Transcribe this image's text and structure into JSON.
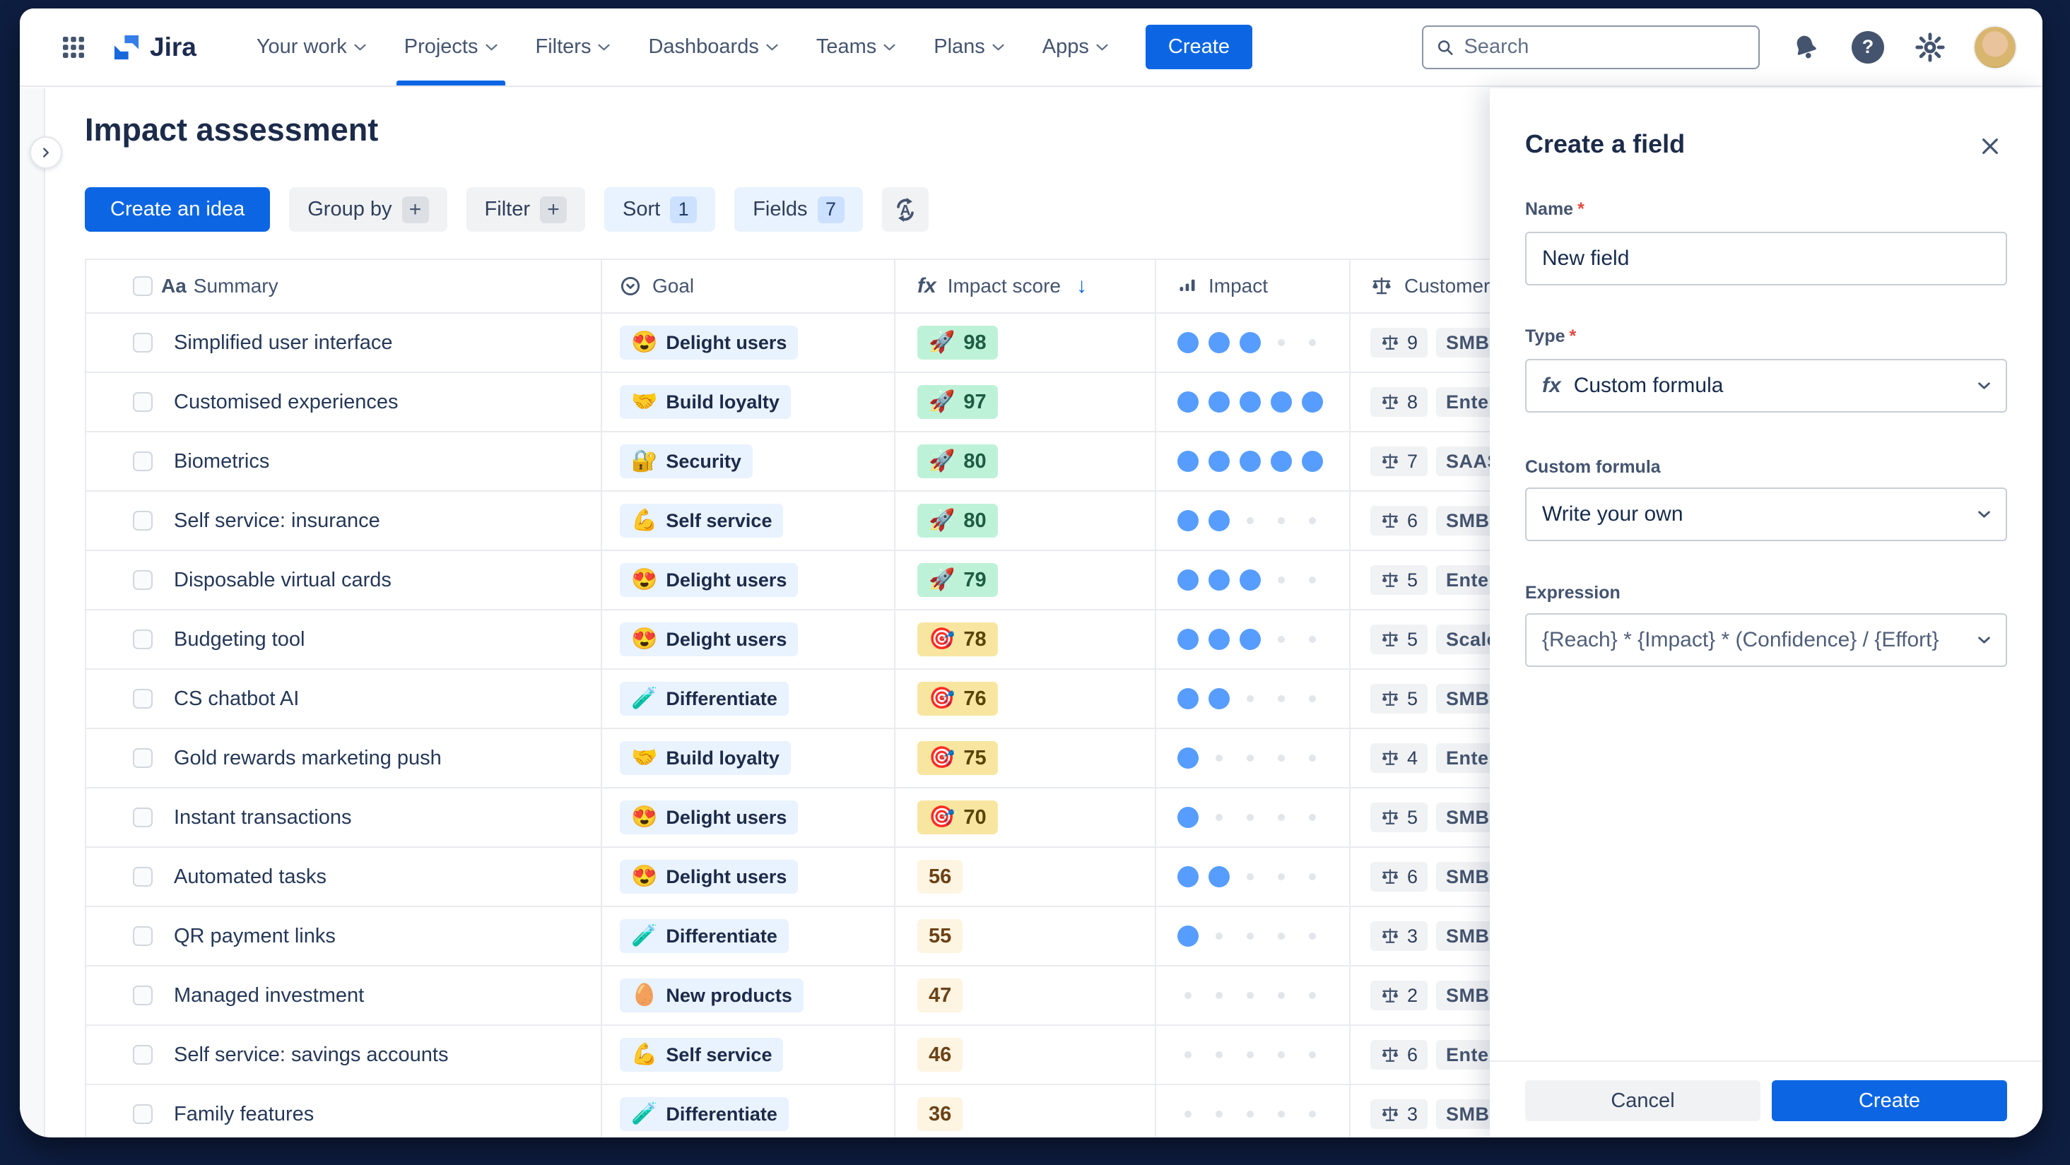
{
  "nav": {
    "logo_text": "Jira",
    "items": [
      {
        "label": "Your work",
        "active": false
      },
      {
        "label": "Projects",
        "active": true
      },
      {
        "label": "Filters",
        "active": false
      },
      {
        "label": "Dashboards",
        "active": false
      },
      {
        "label": "Teams",
        "active": false
      },
      {
        "label": "Plans",
        "active": false
      },
      {
        "label": "Apps",
        "active": false
      }
    ],
    "create_label": "Create",
    "search_placeholder": "Search"
  },
  "page": {
    "title": "Impact assessment"
  },
  "toolbar": {
    "create_idea": "Create an idea",
    "group_by": "Group by",
    "group_by_suffix": "+",
    "filter": "Filter",
    "filter_suffix": "+",
    "sort": "Sort",
    "sort_count": "1",
    "fields": "Fields",
    "fields_count": "7"
  },
  "table": {
    "columns": {
      "summary_icon": "Aa",
      "summary": "Summary",
      "goal": "Goal",
      "score_icon": "fx",
      "impact_score": "Impact score",
      "sort_arrow": "↓",
      "impact": "Impact",
      "customer": "Customer"
    },
    "rows": [
      {
        "summary": "Simplified user interface",
        "goal_emoji": "😍",
        "goal": "Delight users",
        "score_emoji": "🚀",
        "score": "98",
        "score_tier": "high",
        "impact_filled": 3,
        "customer_weight": "9",
        "segment": "SMB"
      },
      {
        "summary": "Customised experiences",
        "goal_emoji": "🤝",
        "goal": "Build loyalty",
        "score_emoji": "🚀",
        "score": "97",
        "score_tier": "high",
        "impact_filled": 5,
        "customer_weight": "8",
        "segment": "Enterprise"
      },
      {
        "summary": "Biometrics",
        "goal_emoji": "🔐",
        "goal": "Security",
        "score_emoji": "🚀",
        "score": "80",
        "score_tier": "high",
        "impact_filled": 5,
        "customer_weight": "7",
        "segment": "SAAS"
      },
      {
        "summary": "Self service: insurance",
        "goal_emoji": "💪",
        "goal": "Self service",
        "score_emoji": "🚀",
        "score": "80",
        "score_tier": "high",
        "impact_filled": 2,
        "customer_weight": "6",
        "segment": "SMB"
      },
      {
        "summary": "Disposable virtual cards",
        "goal_emoji": "😍",
        "goal": "Delight users",
        "score_emoji": "🚀",
        "score": "79",
        "score_tier": "high",
        "impact_filled": 3,
        "customer_weight": "5",
        "segment": "Enterprise"
      },
      {
        "summary": "Budgeting tool",
        "goal_emoji": "😍",
        "goal": "Delight users",
        "score_emoji": "🎯",
        "score": "78",
        "score_tier": "mid",
        "impact_filled": 3,
        "customer_weight": "5",
        "segment": "Scaleup"
      },
      {
        "summary": "CS chatbot AI",
        "goal_emoji": "🧪",
        "goal": "Differentiate",
        "score_emoji": "🎯",
        "score": "76",
        "score_tier": "mid",
        "impact_filled": 2,
        "customer_weight": "5",
        "segment": "SMB"
      },
      {
        "summary": "Gold rewards marketing push",
        "goal_emoji": "🤝",
        "goal": "Build loyalty",
        "score_emoji": "🎯",
        "score": "75",
        "score_tier": "mid",
        "impact_filled": 1,
        "customer_weight": "4",
        "segment": "Enterprise"
      },
      {
        "summary": "Instant transactions",
        "goal_emoji": "😍",
        "goal": "Delight users",
        "score_emoji": "🎯",
        "score": "70",
        "score_tier": "mid",
        "impact_filled": 1,
        "customer_weight": "5",
        "segment": "SMB"
      },
      {
        "summary": "Automated tasks",
        "goal_emoji": "😍",
        "goal": "Delight users",
        "score_emoji": "",
        "score": "56",
        "score_tier": "low",
        "impact_filled": 2,
        "customer_weight": "6",
        "segment": "SMB"
      },
      {
        "summary": "QR payment links",
        "goal_emoji": "🧪",
        "goal": "Differentiate",
        "score_emoji": "",
        "score": "55",
        "score_tier": "low",
        "impact_filled": 1,
        "customer_weight": "3",
        "segment": "SMB"
      },
      {
        "summary": "Managed investment",
        "goal_emoji": "🥚",
        "goal": "New products",
        "score_emoji": "",
        "score": "47",
        "score_tier": "low",
        "impact_filled": 0,
        "customer_weight": "2",
        "segment": "SMB"
      },
      {
        "summary": "Self service: savings accounts",
        "goal_emoji": "💪",
        "goal": "Self service",
        "score_emoji": "",
        "score": "46",
        "score_tier": "low",
        "impact_filled": 0,
        "customer_weight": "6",
        "segment": "Enterprise"
      },
      {
        "summary": "Family features",
        "goal_emoji": "🧪",
        "goal": "Differentiate",
        "score_emoji": "",
        "score": "36",
        "score_tier": "low",
        "impact_filled": 0,
        "customer_weight": "3",
        "segment": "SMB"
      }
    ]
  },
  "panel": {
    "title": "Create a field",
    "name_label": "Name",
    "required_mark": "*",
    "name_value": "New field",
    "type_label": "Type",
    "type_icon": "fx",
    "type_value": "Custom formula",
    "custom_formula_label": "Custom formula",
    "custom_formula_value": "Write your own",
    "expression_label": "Expression",
    "expression_value": "{Reach} * {Impact} * (Confidence} / {Effort}",
    "cancel_label": "Cancel",
    "create_label": "Create"
  },
  "colors": {
    "accent_blue": "#0C66E4",
    "impact_dot_blue": "#579DFF",
    "badge_green_bg": "#BEF2D8",
    "badge_green_text": "#1E5C44",
    "badge_yellow_bg": "#F8E6A0",
    "badge_yellow_text": "#584400",
    "badge_cream_bg": "#FEF4E2",
    "badge_cream_text": "#6B4216",
    "goal_chip_bg": "#E9F2FF",
    "frame_navy": "#0E1E41"
  }
}
